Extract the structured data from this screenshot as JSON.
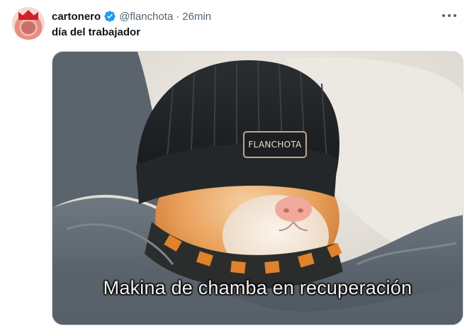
{
  "author": {
    "display_name": "cartonero",
    "handle": "@flanchota",
    "separator": "·",
    "time": "26min",
    "verified": true
  },
  "tweet": {
    "text": "día del trabajador"
  },
  "media": {
    "caption": "Makina de chamba en recuperación",
    "beanie_label": "FLANCHOTA"
  },
  "icons": [
    "avatar",
    "verified-badge-icon",
    "more-options-icon"
  ],
  "colors": {
    "verified": "#1d9bf0",
    "text": "#0f1419",
    "muted": "#536471"
  }
}
